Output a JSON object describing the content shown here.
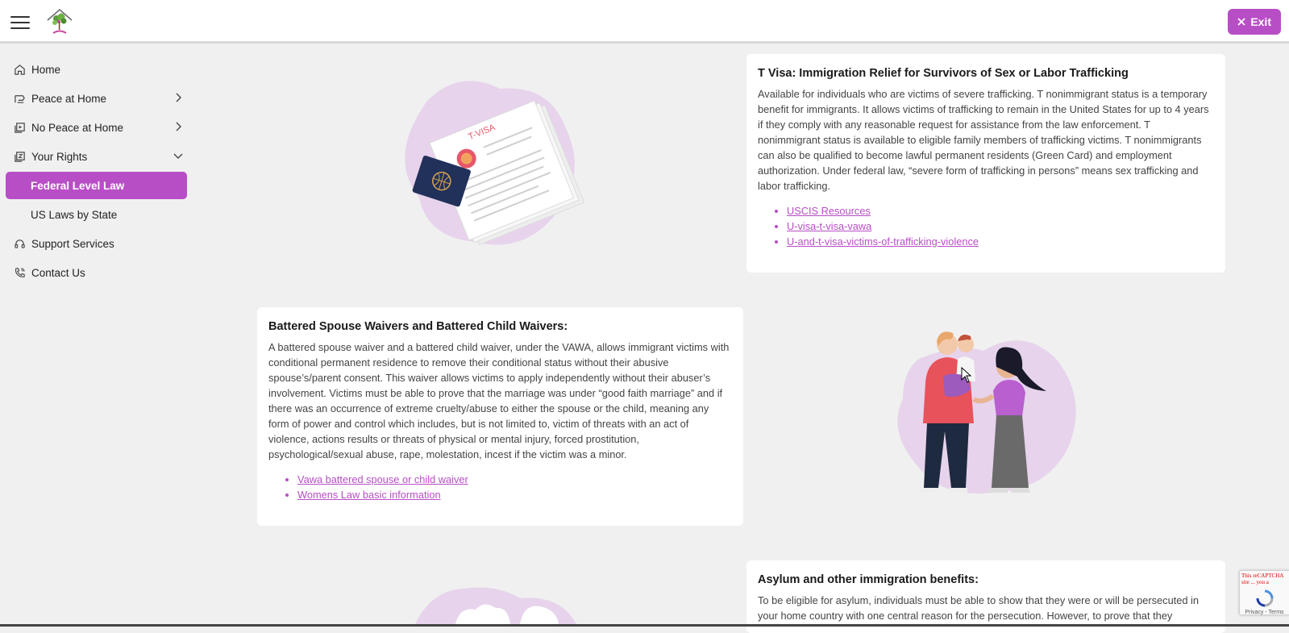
{
  "header": {
    "exit_label": "Exit"
  },
  "sidebar": {
    "items": [
      {
        "label": "Home",
        "icon": "home-icon"
      },
      {
        "label": "Peace at Home",
        "icon": "peace-icon"
      },
      {
        "label": "No Peace at Home",
        "icon": "no-peace-icon"
      },
      {
        "label": "Your Rights",
        "icon": "rights-icon"
      },
      {
        "label": "Federal Level Law"
      },
      {
        "label": "US Laws by State"
      },
      {
        "label": "Support Services",
        "icon": "support-icon"
      },
      {
        "label": "Contact Us",
        "icon": "phone-icon"
      }
    ]
  },
  "cards": {
    "tvisa": {
      "title": "T Visa: Immigration Relief for Survivors of Sex or Labor Trafficking",
      "body": "Available for individuals who are victims of severe trafficking. T nonimmigrant status is a temporary benefit for immigrants. It allows victims of trafficking to remain in the United States for up to 4 years if they comply with any reasonable request for assistance from the law enforcement. T nonimmigrant status is available to eligible family members of trafficking victims. T nonimmigrants can also be qualified to become lawful permanent residents (Green Card) and employment authorization. Under federal law, “severe form of trafficking in persons” means sex trafficking and labor trafficking.",
      "links": [
        "USCIS Resources",
        "U-visa-t-visa-vawa",
        "U-and-t-visa-victims-of-trafficking-violence"
      ],
      "illustration_text": "T-VISA"
    },
    "battered": {
      "title": "Battered Spouse Waivers and Battered Child Waivers:",
      "body": "A battered spouse waiver and a battered child waiver, under the VAWA, allows immigrant victims with conditional permanent residence to remove their conditional status without their abusive spouse’s/parent consent. This waiver allows victims to apply independently without their abuser’s involvement. Victims must be able to prove that the marriage was under “good faith marriage” and if there was an occurrence of extreme cruelty/abuse to either the spouse or the child, meaning any form of power and control which includes, but is not limited to, victim of threats with an act of violence, actions results or threats of physical or mental injury, forced prostitution, psychological/sexual abuse, rape, molestation, incest if the victim was a minor.",
      "links": [
        "Vawa battered spouse or child waiver",
        "Womens Law basic information"
      ]
    },
    "asylum": {
      "title": "Asylum and other immigration benefits:",
      "body": "To be eligible for asylum, individuals must be able to show that they were or will be persecuted in your home country with one central reason for the persecution. However, to prove that they"
    }
  },
  "recaptcha": {
    "error_text": "This reCAPTCHA site ... you a",
    "footer": "Privacy - Terms"
  },
  "colors": {
    "accent": "#b84ec6",
    "background": "#f0f0f0"
  }
}
